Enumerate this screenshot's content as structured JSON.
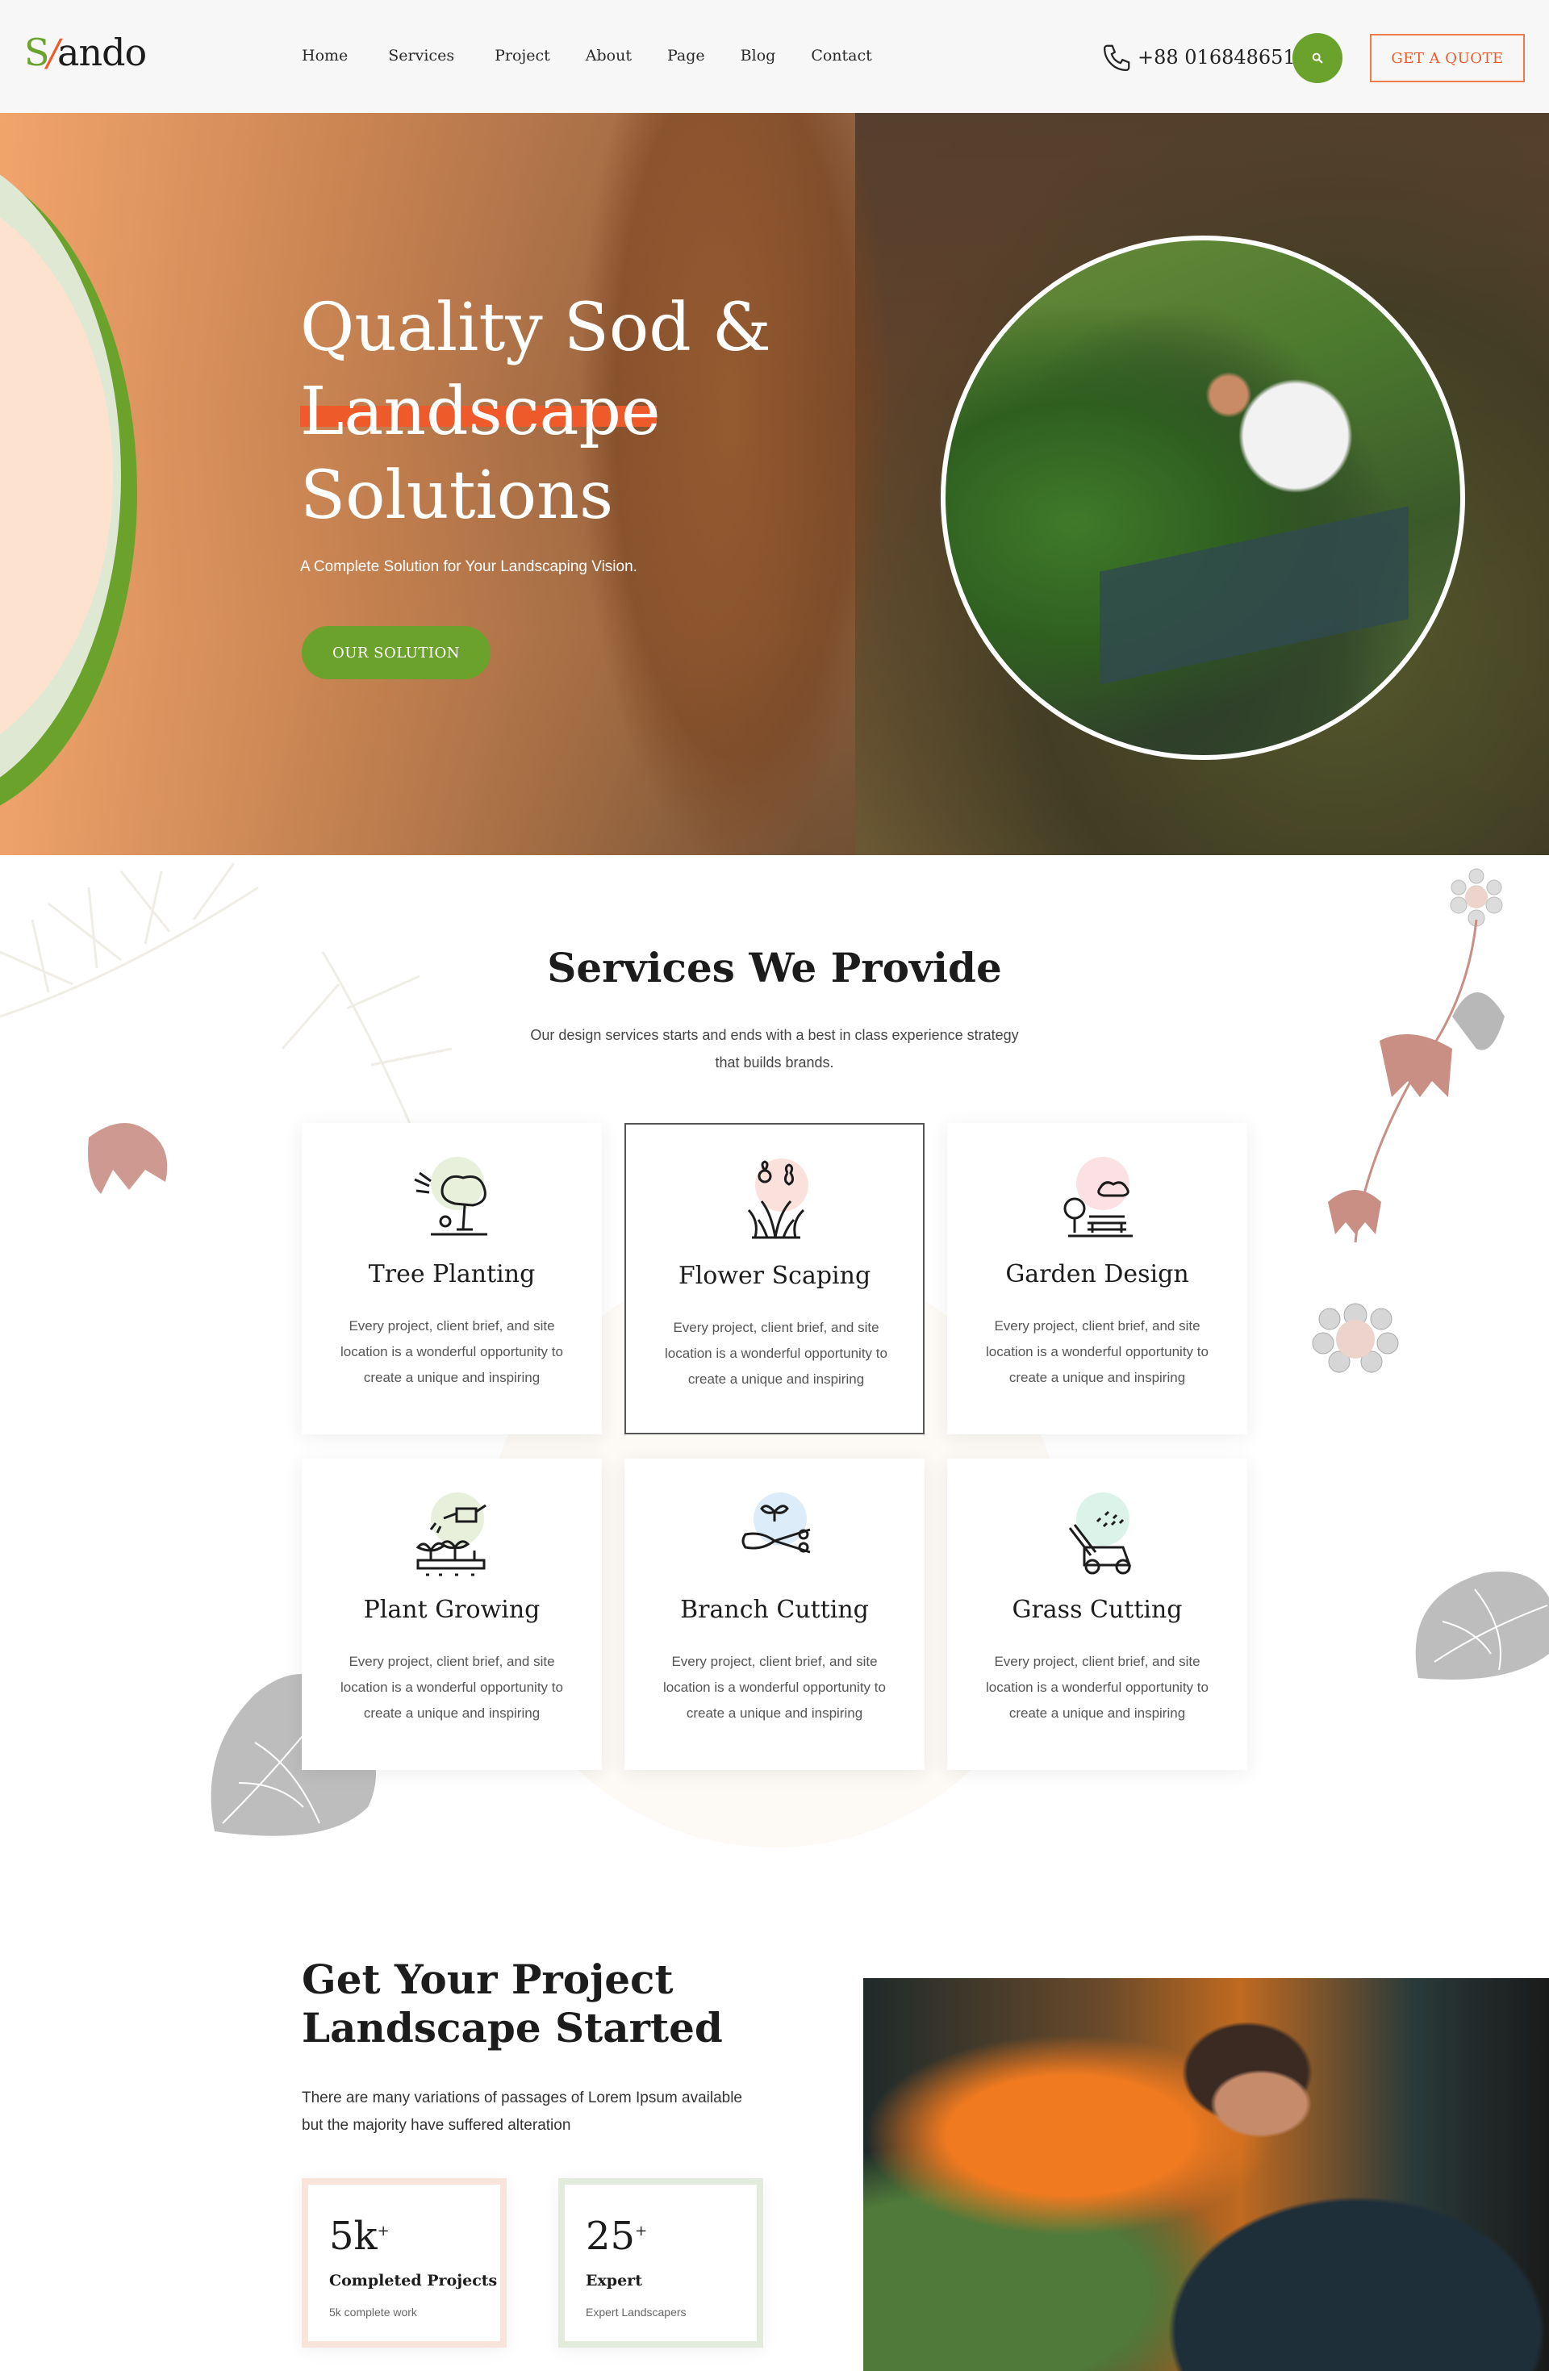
{
  "header": {
    "logo": {
      "part1": "S",
      "slash": "/",
      "part2": "ando"
    },
    "nav": [
      "Home",
      "Services",
      "Project",
      "About",
      "Page",
      "Blog",
      "Contact"
    ],
    "phone": "+88 016848651",
    "quote_label": "GET A QUOTE"
  },
  "hero": {
    "title_line1": "Quality Sod &",
    "title_line2": "Landscape",
    "title_line3": "Solutions",
    "subtitle": "A Complete Solution for Your Landscaping Vision.",
    "button_label": "OUR SOLUTION"
  },
  "services": {
    "title": "Services We Provide",
    "description": "Our design services starts and ends with a best in class experience strategy that builds brands.",
    "cards": [
      {
        "title": "Tree Planting",
        "text": "Every project, client brief, and site location is a wonderful opportunity to create a unique and inspiring",
        "icon": "tree-planting-icon",
        "bubble": "#e8f0dc"
      },
      {
        "title": "Flower Scaping",
        "text": "Every project, client brief, and site location is a wonderful opportunity to create a unique and inspiring",
        "icon": "flower-scaping-icon",
        "bubble": "#fbe1dc"
      },
      {
        "title": "Garden Design",
        "text": "Every project, client brief, and site location is a wonderful opportunity to create a unique and inspiring",
        "icon": "garden-design-icon",
        "bubble": "#fbe1e4"
      },
      {
        "title": "Plant Growing",
        "text": "Every project, client brief, and site location is a wonderful opportunity to create a unique and inspiring",
        "icon": "plant-growing-icon",
        "bubble": "#e8f0dc"
      },
      {
        "title": "Branch Cutting",
        "text": "Every project, client brief, and site location is a wonderful opportunity to create a unique and inspiring",
        "icon": "branch-cutting-icon",
        "bubble": "#dcecf8"
      },
      {
        "title": "Grass Cutting",
        "text": "Every project, client brief, and site location is a wonderful opportunity to create a unique and inspiring",
        "icon": "grass-cutting-icon",
        "bubble": "#dcf3ea"
      }
    ]
  },
  "project": {
    "title_line1": "Get Your Project",
    "title_line2": "Landscape Started",
    "text": "There are many variations of passages of Lorem Ipsum available but the majority have suffered alteration",
    "stats": [
      {
        "number": "5k",
        "plus": "+",
        "label": "Completed Projects",
        "sub": "5k complete work",
        "border": "#f9e4dc"
      },
      {
        "number": "25",
        "plus": "+",
        "label": "Expert",
        "sub": "Expert Landscapers",
        "border": "#e3ebdd"
      }
    ]
  },
  "colors": {
    "accent_green": "#6aa22c",
    "accent_orange": "#ef5a2b"
  }
}
